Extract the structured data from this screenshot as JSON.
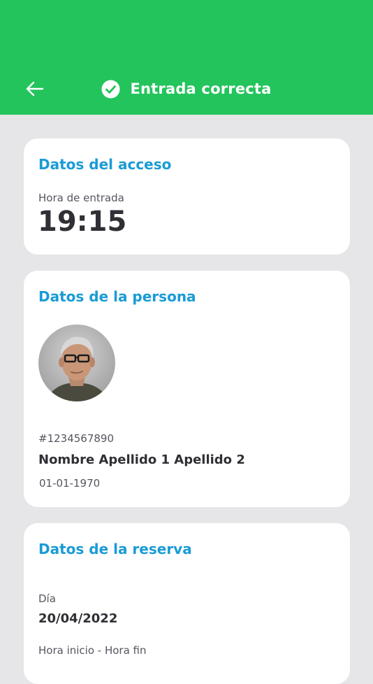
{
  "header": {
    "title": "Entrada correcta",
    "color": "#23c45c",
    "back_icon": "arrow-left-icon",
    "status_icon": "check-circle-icon"
  },
  "access": {
    "section_title": "Datos del acceso",
    "entry_label": "Hora de entrada",
    "entry_time": "19:15"
  },
  "person": {
    "section_title": "Datos de la persona",
    "avatar_icon": "profile-photo",
    "id": "#1234567890",
    "name": "Nombre Apellido 1 Apellido 2",
    "birthdate": "01-01-1970"
  },
  "booking": {
    "section_title": "Datos de la reserva",
    "day_label": "Día",
    "day_value": "20/04/2022",
    "time_label": "Hora inicio - Hora fin"
  },
  "accent_color": "#1a9bd6"
}
